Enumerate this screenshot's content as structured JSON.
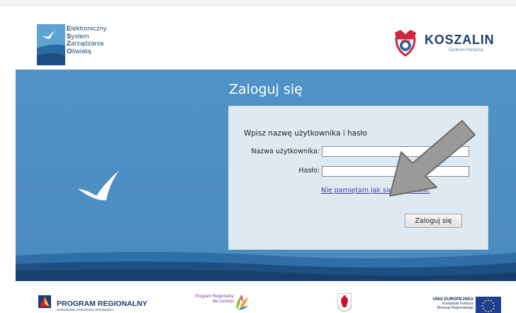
{
  "header": {
    "esz_logo": {
      "lines": [
        {
          "initial": "E",
          "rest": "lektroniczny"
        },
        {
          "initial": "S",
          "rest": "ystem"
        },
        {
          "initial": "Z",
          "rest": "arządzania"
        },
        {
          "initial": "O",
          "rest": "światą"
        }
      ]
    },
    "koszalin_logo": {
      "name": "KOSZALIN",
      "subtitle": "Centrum Pomorza"
    }
  },
  "login": {
    "title": "Zaloguj się",
    "prompt": "Wpisz nazwę użytkownika i hasło",
    "username_label": "Nazwa użytkownika:",
    "username_value": "",
    "password_label": "Hasło:",
    "password_value": "",
    "forgot_link": "Nie pamiętam jak się zalogować",
    "submit_label": "Zaloguj się"
  },
  "footer": {
    "program_regionalny": {
      "title": "PROGRAM REGIONALNY",
      "subtitle": "NARODOWA STRATEGIA SPÓJNOŚCI"
    },
    "prdr": {
      "text": "Program Regionalny dla rozwoju"
    },
    "eu": {
      "title": "UNIA EUROPEJSKA",
      "line1": "Europejski Fundusz",
      "line2": "Rozwoju Regionalnego"
    }
  },
  "colors": {
    "banner_blue": "#4f93c6",
    "panel_bg": "#dfe9f2",
    "link_purple": "#4b3ba6",
    "brand_navy": "#1f3f66",
    "koszalin_red": "#d0263d"
  },
  "icons": {
    "esz_mark": "esz-logo-icon",
    "koszalin_mark": "koszalin-crest-icon",
    "bird": "bird-icon",
    "arrow": "annotation-arrow-icon"
  }
}
